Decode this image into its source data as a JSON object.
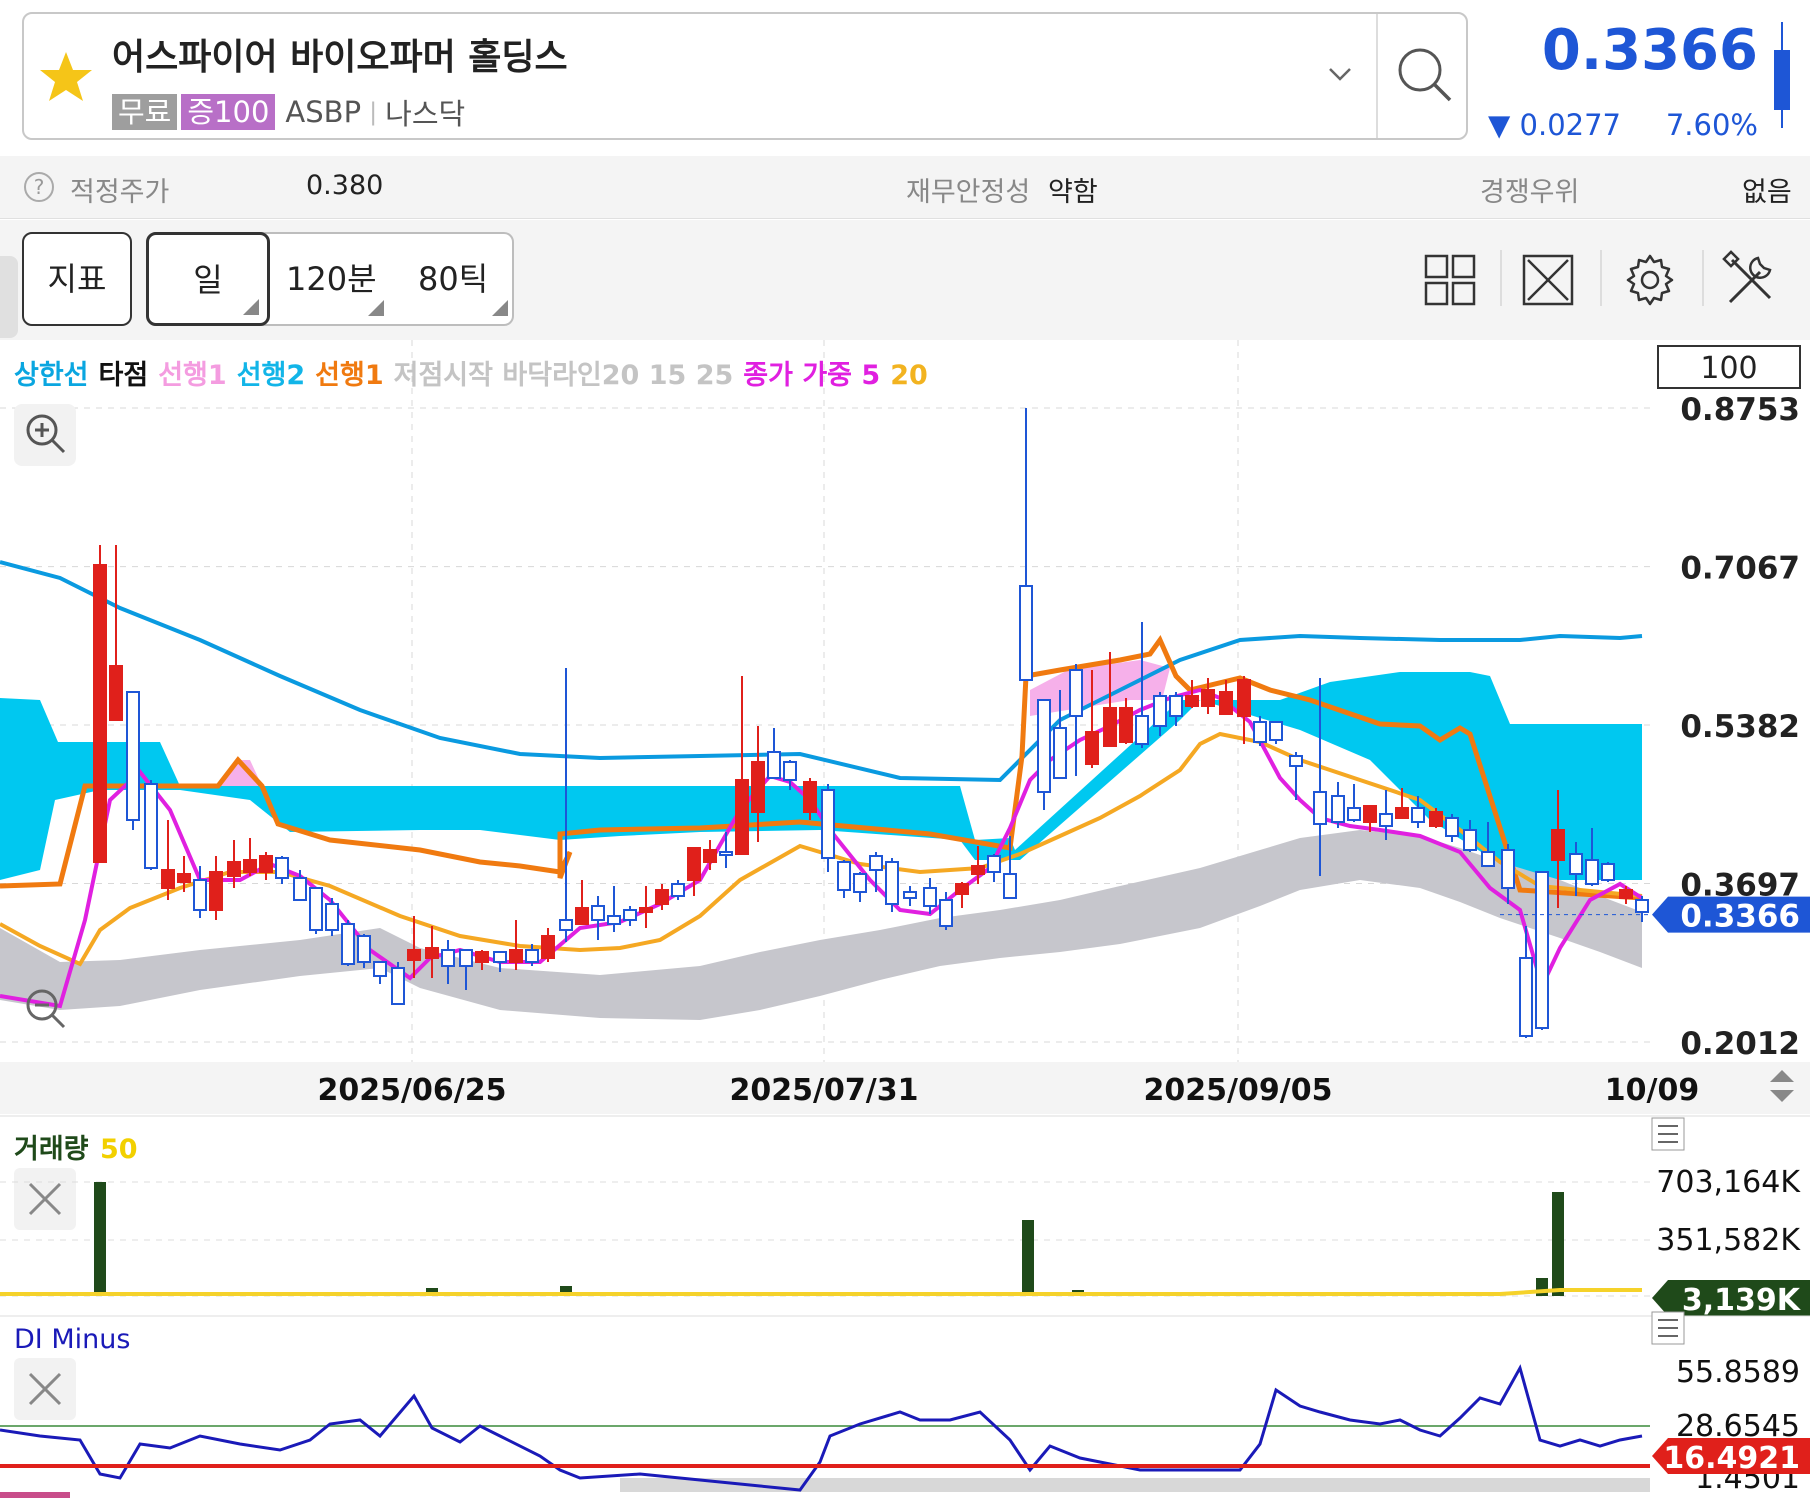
{
  "header": {
    "stock_name": "어스파이어 바이오파머 홀딩스",
    "tag_free": "무료",
    "tag_margin": "증100",
    "ticker": "ASBP",
    "separator": "|",
    "market": "나스닥",
    "price": "0.3366",
    "change": "▼ 0.0277",
    "change_pct": "7.60%",
    "colors": {
      "price": "#1e56d6",
      "star": "#f5c518"
    }
  },
  "info_row": {
    "fair_price_label": "적정주가",
    "fair_price_value": "0.380",
    "stability_label": "재무안정성",
    "stability_value": "약함",
    "competitive_label": "경쟁우위",
    "competitive_value": "없음"
  },
  "toolbar": {
    "indicator_label": "지표",
    "period_day": "일",
    "period_120min": "120분",
    "period_80tick": "80틱",
    "icons": [
      "layout-grid-icon",
      "expand-icon",
      "gear-icon",
      "tools-icon"
    ]
  },
  "legend": [
    {
      "text": "상한선",
      "color": "#0aa6e0"
    },
    {
      "text": "타점",
      "color": "#111111"
    },
    {
      "text": "선행1",
      "color": "#f49ce0"
    },
    {
      "text": "선행2",
      "color": "#12b5e8"
    },
    {
      "text": "선행1",
      "color": "#f07a10"
    },
    {
      "text": "저점시작 바닥라인20 15 25",
      "color": "#c4c4c4"
    },
    {
      "text": "종가 가중 5",
      "color": "#e020e0"
    },
    {
      "text": "20",
      "color": "#f2b320"
    }
  ],
  "chart_data": [
    {
      "type": "candlestick",
      "title": "",
      "scale_box": "100",
      "y_ticks": [
        "0.8753",
        "0.7067",
        "0.5382",
        "0.3697",
        "0.2012"
      ],
      "ylim": [
        0.2012,
        0.8753
      ],
      "current_price_label": "0.3366",
      "x_ticks": [
        "2025/06/25",
        "2025/07/31",
        "2025/09/05",
        "10/09"
      ],
      "colors": {
        "up": "#e0201b",
        "down": "#1e56d6",
        "current": "#1e56d6"
      }
    },
    {
      "type": "bar",
      "title": "거래량",
      "ma_label": "50",
      "y_ticks": [
        "703,164K",
        "351,582K",
        "0"
      ],
      "current_label": "3,139K",
      "colors": {
        "bar": "#1f4a1a",
        "ma": "#f5d22a",
        "current": "#1f4a1a"
      }
    },
    {
      "type": "line",
      "title": "DI Minus",
      "y_ticks": [
        "55.8589",
        "28.6545",
        "1.4501"
      ],
      "current_label": "16.4921",
      "colors": {
        "line": "#1a1ab8",
        "ref": "#e0201b",
        "current": "#e0201b"
      }
    }
  ]
}
